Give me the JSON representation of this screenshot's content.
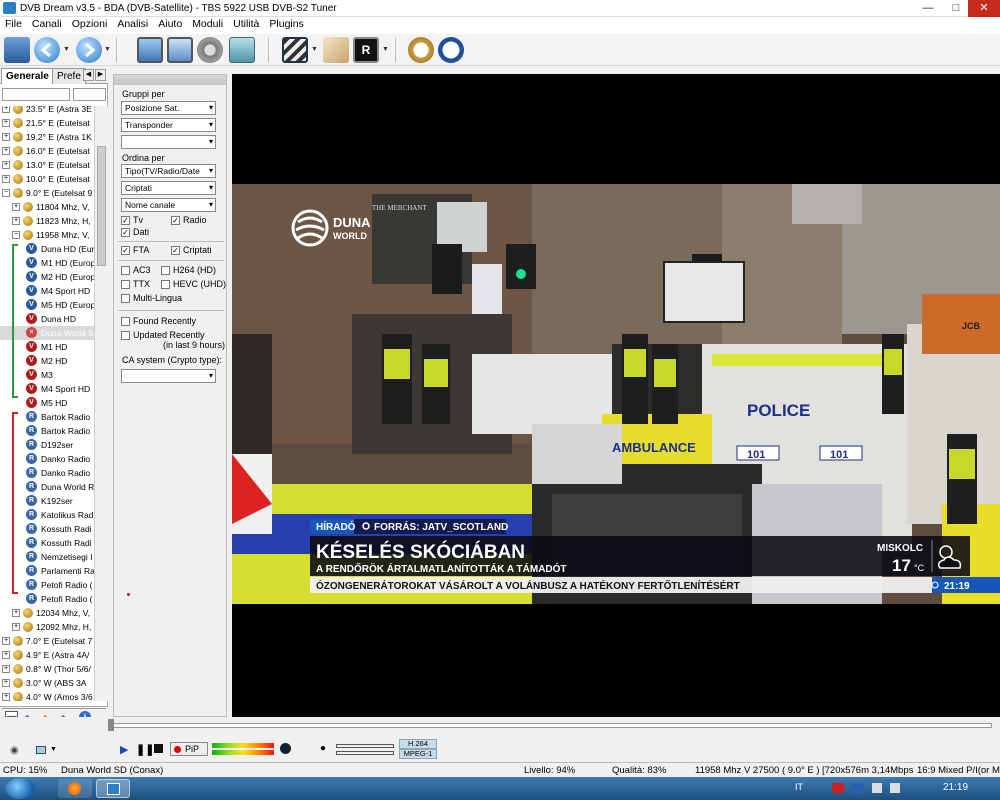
{
  "window": {
    "title": "DVB Dream v3.5   -  BDA (DVB-Satellite)  -  TBS 5922 USB DVB-S2 Tuner"
  },
  "menu": [
    "File",
    "Canali",
    "Opzioni",
    "Analisi",
    "Aiuto",
    "Moduli",
    "Utilità",
    "Plugins"
  ],
  "left_tabs": {
    "general": "Generale",
    "prefs": "Prefe"
  },
  "tree": [
    {
      "type": "sat",
      "label": "23.5° E (Astra 3E"
    },
    {
      "type": "sat",
      "label": "21.5° E (Eutelsat"
    },
    {
      "type": "sat",
      "label": "19.2° E (Astra 1K"
    },
    {
      "type": "sat",
      "label": "16.0° E (Eutelsat"
    },
    {
      "type": "sat",
      "label": "13.0° E (Eutelsat"
    },
    {
      "type": "sat",
      "label": "10.0° E (Eutelsat"
    },
    {
      "type": "sat",
      "label": "9.0° E (Eutelsat 9"
    },
    {
      "type": "tp",
      "label": "11804 Mhz, V,"
    },
    {
      "type": "tp",
      "label": "11823 Mhz, H,"
    },
    {
      "type": "tp",
      "label": "11958 Mhz, V,"
    },
    {
      "type": "tv",
      "label": "Duna HD (Eur"
    },
    {
      "type": "tv",
      "label": "M1 HD (Europ"
    },
    {
      "type": "tv",
      "label": "M2 HD (Europ"
    },
    {
      "type": "tv",
      "label": "M4 Sport HD"
    },
    {
      "type": "tv",
      "label": "M5 HD (Europ"
    },
    {
      "type": "tvr",
      "label": "Duna HD"
    },
    {
      "type": "sel",
      "label": "Duna World S"
    },
    {
      "type": "tvr",
      "label": "M1 HD"
    },
    {
      "type": "tvr",
      "label": "M2 HD"
    },
    {
      "type": "tvr",
      "label": "M3"
    },
    {
      "type": "tvr",
      "label": "M4 Sport HD"
    },
    {
      "type": "tvr",
      "label": "M5 HD"
    },
    {
      "type": "radio",
      "label": "Bartok Radio"
    },
    {
      "type": "radio",
      "label": "Bartok Radio"
    },
    {
      "type": "radio",
      "label": "D192ser"
    },
    {
      "type": "radio",
      "label": "Danko Radio"
    },
    {
      "type": "radio",
      "label": "Danko Radio"
    },
    {
      "type": "radio",
      "label": "Duna World R"
    },
    {
      "type": "radio",
      "label": "K192ser"
    },
    {
      "type": "radio",
      "label": "Katolikus Rad"
    },
    {
      "type": "radio",
      "label": "Kossuth Radi"
    },
    {
      "type": "radio",
      "label": "Kossuth Radi"
    },
    {
      "type": "radio",
      "label": "Nemzetisegi I"
    },
    {
      "type": "radio",
      "label": "Parlamenti Ra"
    },
    {
      "type": "radio",
      "label": "Petofi Radio ("
    },
    {
      "type": "radio",
      "label": "Petofi Radio ("
    },
    {
      "type": "tp",
      "label": "12034 Mhz, V,"
    },
    {
      "type": "tp",
      "label": "12092 Mhz, H,"
    },
    {
      "type": "sat",
      "label": "7.0° E (Eutelsat 7"
    },
    {
      "type": "sat",
      "label": "4.9° E (Astra 4A/"
    },
    {
      "type": "sat",
      "label": "0.8° W (Thor 5/6/"
    },
    {
      "type": "sat",
      "label": "3.0° W (ABS 3A"
    },
    {
      "type": "sat",
      "label": "4.0° W (Amos 3/6"
    }
  ],
  "filter": {
    "group_by": "Gruppi per",
    "group1": "Posizione Sat.",
    "group2": "Transponder",
    "group3": "",
    "sort_by": "Ordina per",
    "sort1": "Tipo(TV/Radio/Date",
    "sort2": "Criptati",
    "sort3": "Nome canale",
    "tv": "Tv",
    "radio": "Radio",
    "data": "Dati",
    "fta": "FTA",
    "crypted": "Criptati",
    "ac3": "AC3",
    "h264": "H264 (HD)",
    "ttx": "TTX",
    "hevc": "HEVC (UHD)",
    "multi": "Multi-Lingua",
    "found": "Found Recently",
    "updated": "Updated Recently",
    "updated_sub": "(in last 9 hours)",
    "ca": "CA system (Crypto type):",
    "ca_value": ""
  },
  "video": {
    "logo_line1": "DUNA",
    "logo_line2": "WORLD",
    "tag": "HÍRADÓ",
    "source": "FORRÁS: JATV_SCOTLAND",
    "headline": "KÉSELÉS SKÓCIÁBAN",
    "subhead": "A RENDŐRÖK ÁRTALMATLANÍTOTTÁK A TÁMADÓT",
    "city": "MISKOLC",
    "temp": "17",
    "temp_unit": "°C",
    "ticker": "ÓZONGENERÁTOROKAT VÁSÁROLT A VOLÁNBUSZ A HATÉKONY FERTŐTLENÍTÉSÉRT",
    "clock": "21:19",
    "police_text": "POLICE",
    "ambulance_text": "AMBULANCE",
    "plate": "101",
    "sign_text": "THE MERCHANT",
    "jcb": "JCB"
  },
  "controls": {
    "pip": "PiP",
    "codec": "H.264",
    "audio_codec": "MPEG-1"
  },
  "status": {
    "cpu": "CPU: 15%",
    "channel": "Duna World SD (Conax)",
    "level": "Livello: 94%",
    "quality": "Qualità: 83%",
    "tuning": "11958 Mhz  V  27500  ( 9.0° E )",
    "resolution": "[720x576m  3,14Mbps",
    "aspect": "16:9 Mixed P/I(or M"
  },
  "taskbar": {
    "lang": "IT",
    "clock": "21:19"
  }
}
